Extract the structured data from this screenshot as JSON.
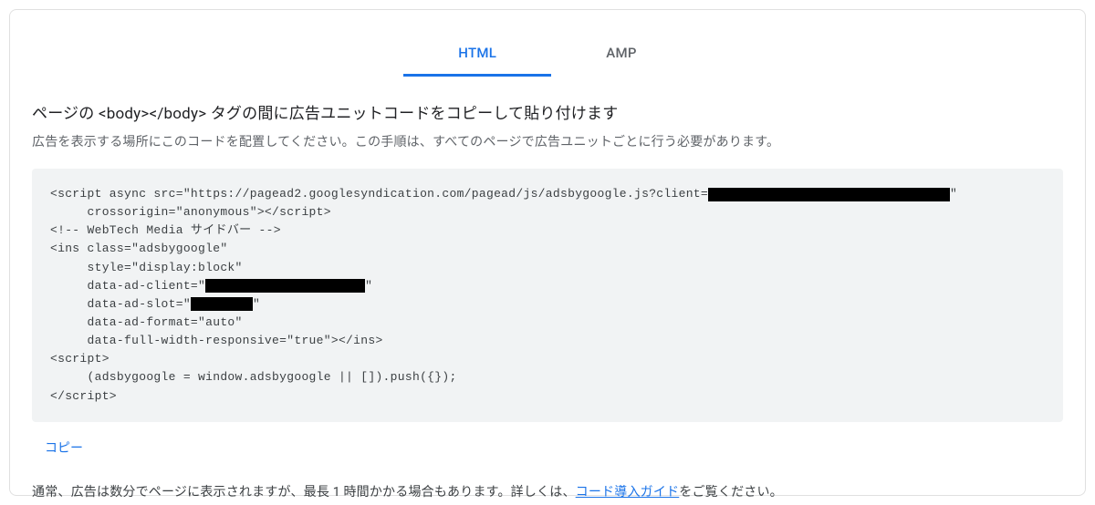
{
  "tabs": {
    "html": "HTML",
    "amp": "AMP"
  },
  "heading": "ページの <body></body> タグの間に広告ユニットコードをコピーして貼り付けます",
  "subheading": "広告を表示する場所にこのコードを配置してください。この手順は、すべてのページで広告ユニットごとに行う必要があります。",
  "code": {
    "l1a": "<script async src=\"https://pagead2.googlesyndication.com/pagead/js/adsbygoogle.js?client=",
    "l1b": "\"",
    "l2": "     crossorigin=\"anonymous\"></script>",
    "l3": "<!-- WebTech Media サイドバー -->",
    "l4": "<ins class=\"adsbygoogle\"",
    "l5": "     style=\"display:block\"",
    "l6a": "     data-ad-client=\"",
    "l6b": "\"",
    "l7a": "     data-ad-slot=\"",
    "l7b": "\"",
    "l8": "     data-ad-format=\"auto\"",
    "l9": "     data-full-width-responsive=\"true\"></ins>",
    "l10": "<script>",
    "l11": "     (adsbygoogle = window.adsbygoogle || []).push({});",
    "l12": "</script>"
  },
  "copy_label": "コピー",
  "footer": {
    "prefix": "通常、広告は数分でページに表示されますが、最長 1 時間かかる場合もあります。詳しくは、",
    "link": "コード導入ガイド",
    "suffix": "をご覧ください。"
  }
}
